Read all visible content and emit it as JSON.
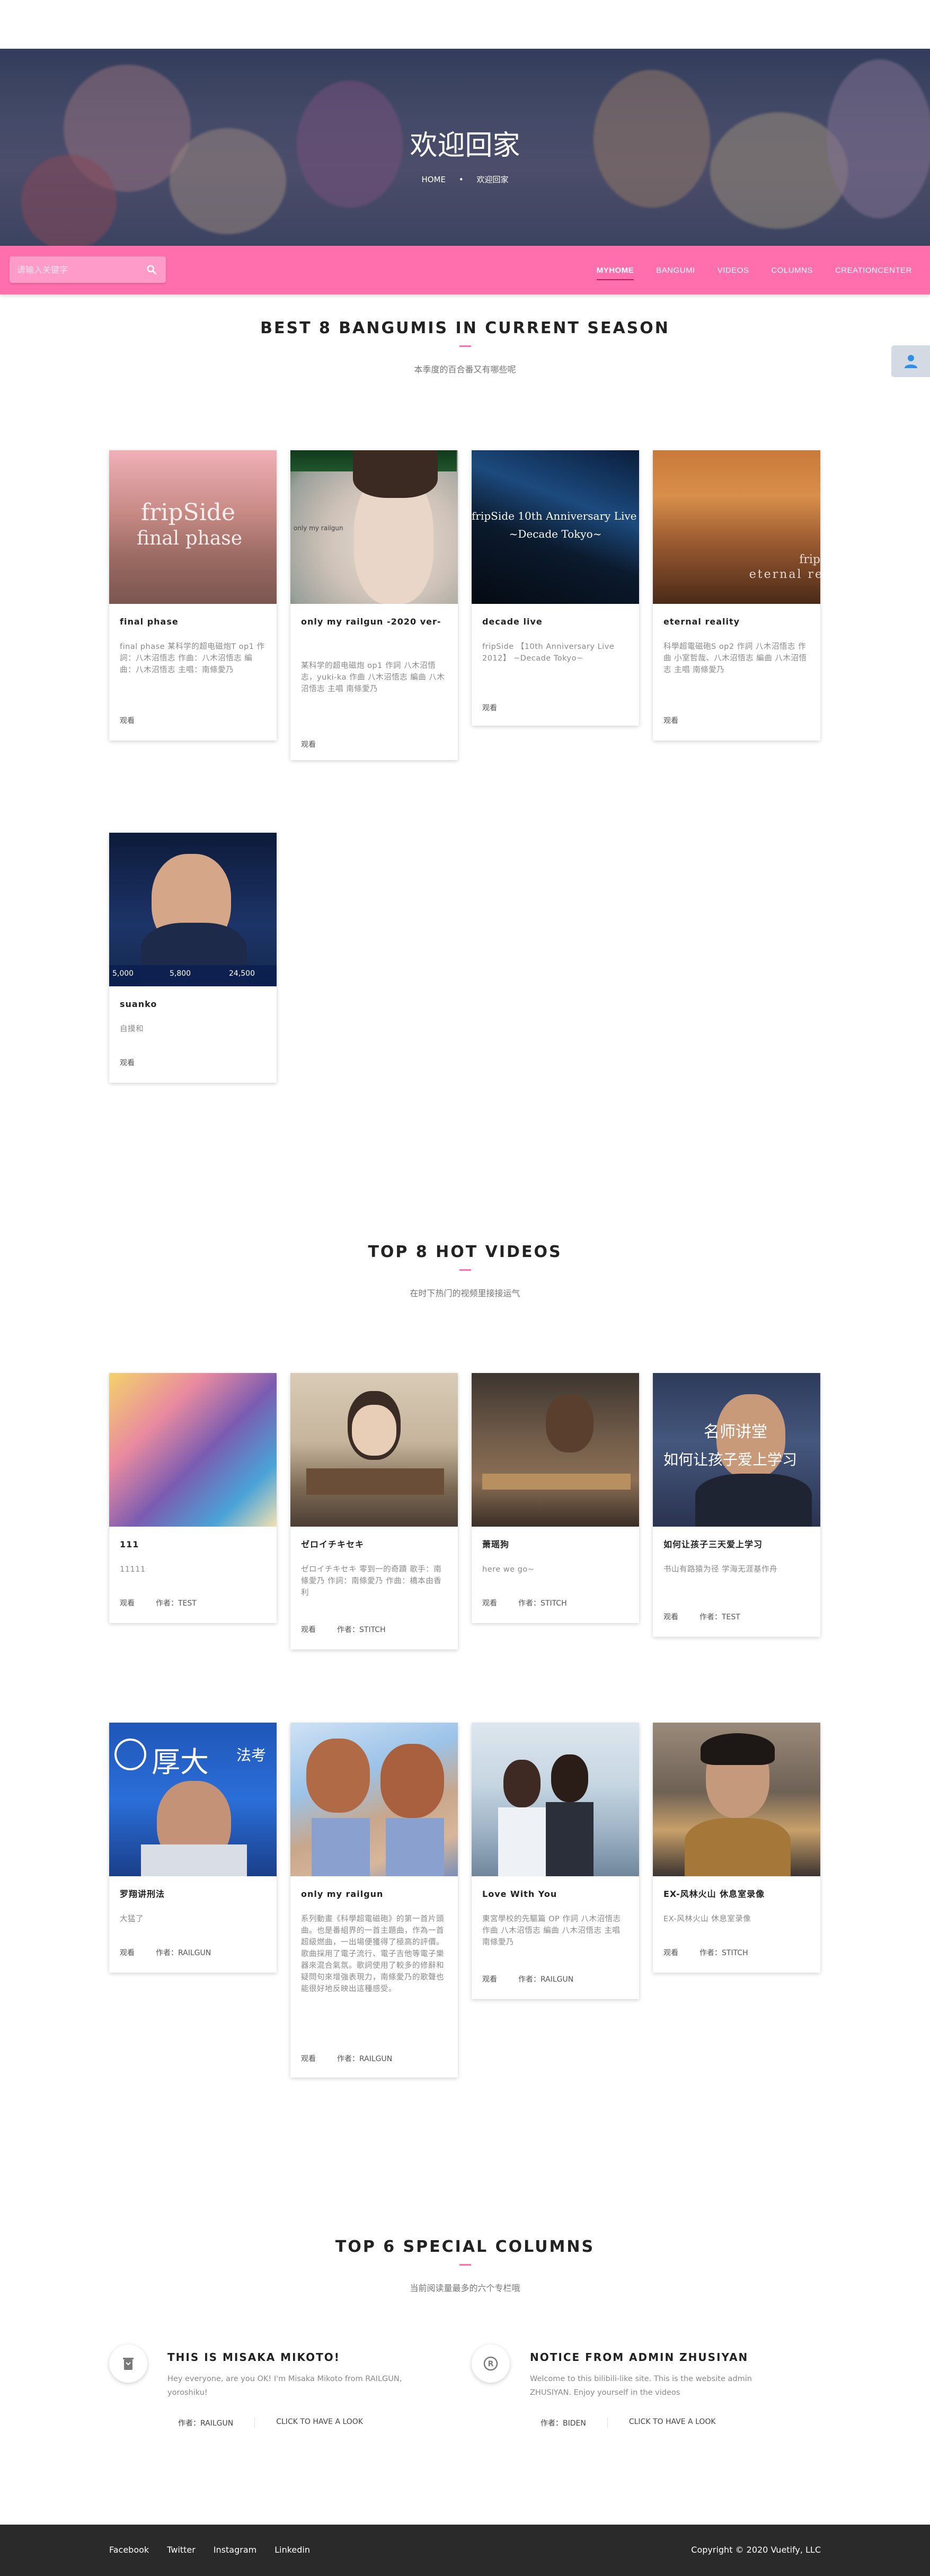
{
  "hero": {
    "title": "欢迎回家",
    "breadcrumb": [
      "HOME",
      "•",
      "欢迎回家"
    ]
  },
  "nav": {
    "search_placeholder": "请输入关键字",
    "links": [
      "MYHOME",
      "BANGUMI",
      "VIDEOS",
      "COLUMNS",
      "CREATIONCENTER"
    ]
  },
  "bangumi": {
    "title": "BEST 8 BANGUMIS IN CURRENT SEASON",
    "subtitle": "本季度的百合番又有哪些呢",
    "cards": [
      {
        "title": "final phase",
        "desc": "final phase 某科学的超电磁炮T op1 作詞：八木沼悟志 作曲：八木沼悟志 編曲：八木沼悟志 主唱：南條愛乃",
        "action": "观看",
        "thumb_text": [
          "fripSide",
          "final phase"
        ]
      },
      {
        "title": "only my railgun -2020 ver-",
        "desc": "某科学的超电磁炮 op1 作詞 八木沼悟志，yuki-ka 作曲 八木沼悟志 編曲 八木沼悟志 主唱 南條愛乃",
        "action": "观看",
        "thumb_text": [
          "only my railgun"
        ]
      },
      {
        "title": "decade live",
        "desc": "fripSide 【10th Anniversary Live 2012】 ~Decade Tokyo~",
        "action": "观看",
        "thumb_text": [
          "fripSide 10th Anniversary Live 2012",
          "~Decade Tokyo~"
        ]
      },
      {
        "title": "eternal reality",
        "desc": "科學超電磁砲S op2 作詞 八木沼悟志 作曲 小室哲哉、八木沼悟志 編曲 八木沼悟志 主唱 南條愛乃",
        "action": "观看",
        "thumb_text": [
          "frip",
          "eternal re"
        ]
      },
      {
        "title": "suanko",
        "desc": "自摸和",
        "action": "观看",
        "thumb_text": [
          "5,000",
          "5,800",
          "24,500"
        ]
      }
    ]
  },
  "videos": {
    "title": "TOP 8 HOT VIDEOS",
    "subtitle": "在时下热门的视频里接接运气",
    "author_label": "作者：",
    "cards": [
      {
        "title": "111",
        "desc": "11111",
        "action": "观看",
        "author": "TEST"
      },
      {
        "title": "ゼロイチキセキ",
        "desc": "ゼロイチキセキ 零到一的奇蹟 歌手：南條愛乃 作詞：南條愛乃 作曲：橋本由香利",
        "action": "观看",
        "author": "STITCH"
      },
      {
        "title": "萧瑶狗",
        "desc": "here we go~",
        "action": "观看",
        "author": "STITCH"
      },
      {
        "title": "如何让孩子三天爱上学习",
        "desc": "书山有路猿为径 学海无涯基作舟",
        "action": "观看",
        "author": "TEST",
        "thumb_text": [
          "名师讲堂",
          "如何让孩子爱上学习"
        ]
      },
      {
        "title": "罗翔讲刑法",
        "desc": "大猛了",
        "action": "观看",
        "author": "RAILGUN",
        "thumb_text": [
          "厚大",
          "法考"
        ]
      },
      {
        "title": "only my railgun",
        "desc": "系列動畫《科學超電磁砲》的第一首片頭曲。也是番組界的一首主題曲，作為一首超級燃曲，一出場便獲得了極高的評價。歌曲採用了電子流行、電子吉他等電子樂器來混合氣氛。歌詞使用了較多的修辭和疑問句來增強表現力，南條愛乃的歌聲也能很好地反映出這種感受。",
        "action": "观看",
        "author": "RAILGUN"
      },
      {
        "title": "Love With You",
        "desc": "東宮學校的先驅篇 OP 作詞 八木沼悟志 作曲 八木沼悟志 編曲 八木沼悟志 主唱 南條愛乃",
        "action": "观看",
        "author": "RAILGUN"
      },
      {
        "title": "EX-风林火山 休息室录像",
        "desc": "EX-风林火山 休息室录像",
        "action": "观看",
        "author": "STITCH"
      }
    ]
  },
  "columns": {
    "title": "TOP 6 SPECIAL COLUMNS",
    "subtitle": "当前阅读量最多的六个专栏哦",
    "items": [
      {
        "title": "THIS IS MISAKA MIKOTO!",
        "desc": "Hey everyone, are you OK! I'm Misaka Mikoto from RAILGUN, yoroshiku!",
        "author": "作者：RAILGUN",
        "action": "CLICK TO HAVE A LOOK",
        "icon": "trash-icon"
      },
      {
        "title": "NOTICE FROM ADMIN ZHUSIYAN",
        "desc": "Welcome to this bilibili-like site. This is the website admin ZHUSIYAN. Enjoy yourself in the videos",
        "author": "作者：BIDEN",
        "action": "CLICK TO HAVE A LOOK",
        "icon": "copyright-icon"
      }
    ]
  },
  "footer": {
    "links": [
      "Facebook",
      "Twitter",
      "Instagram",
      "Linkedin"
    ],
    "copyright": "Copyright © 2020 Vuetify, LLC"
  },
  "colors": {
    "accent": "#ff6fae",
    "footer": "#2a2a2a"
  }
}
